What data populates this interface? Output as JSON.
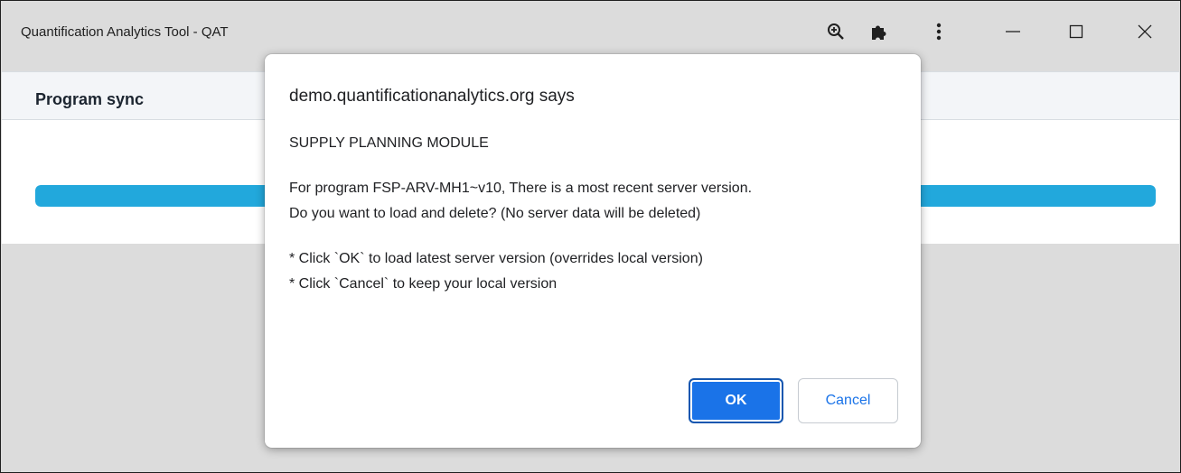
{
  "window": {
    "title": "Quantification Analytics Tool - QAT",
    "controls": {
      "zoom_icon": "zoom-in-icon",
      "extension_icon": "puzzle-icon",
      "menu_icon": "more-vertical-icon",
      "minimize_icon": "minimize-icon",
      "maximize_icon": "maximize-icon",
      "close_icon": "close-icon"
    }
  },
  "page": {
    "card_title": "Program sync",
    "progress_percent": 100,
    "progress_color": "#22a8dc"
  },
  "dialog": {
    "origin": "demo.quantificationanalytics.org says",
    "lines": {
      "l1": "SUPPLY PLANNING MODULE",
      "l2": "For program FSP-ARV-MH1~v10, There is a most recent server version.",
      "l3": "Do you want to load and delete? (No server data will be deleted)",
      "l4": "* Click `OK` to load latest server version (overrides local version)",
      "l5": "* Click `Cancel` to keep your local version"
    },
    "ok_label": "OK",
    "cancel_label": "Cancel",
    "accent_color": "#1a73e8"
  }
}
